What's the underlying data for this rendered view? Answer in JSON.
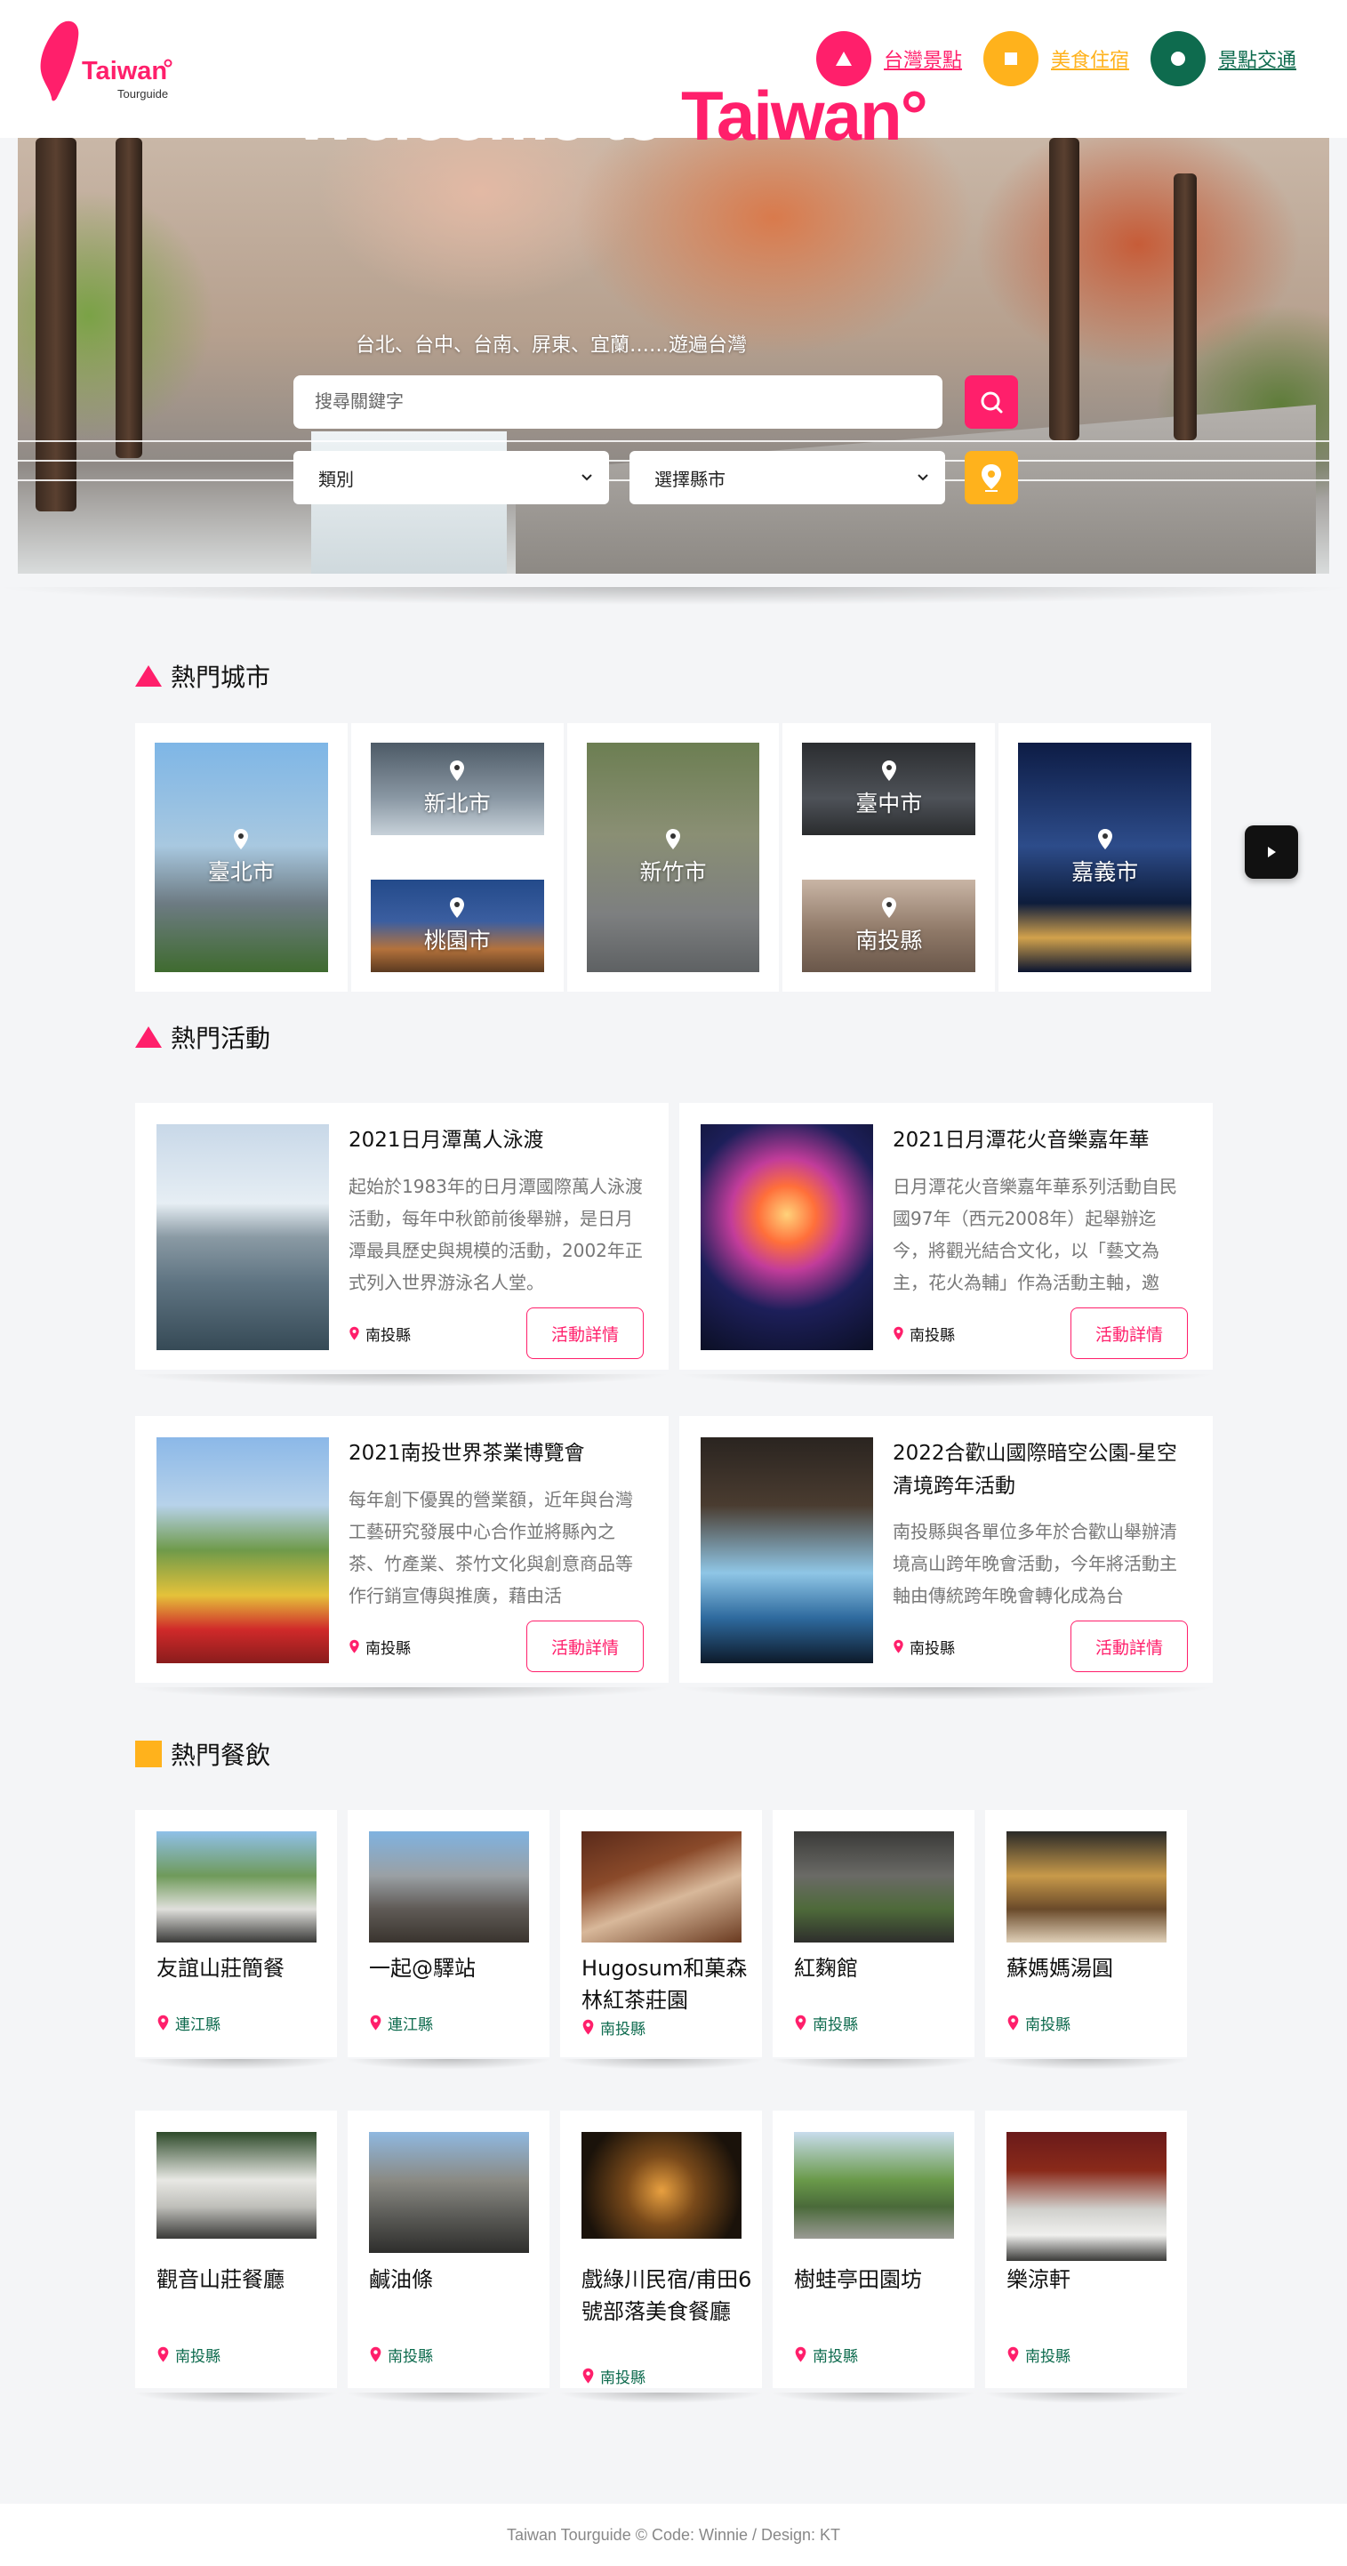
{
  "header": {
    "logo_text": "Taiwan",
    "logo_sub": "Tourguide",
    "nav": [
      {
        "label": "台灣景點",
        "color": "#ff1f6b"
      },
      {
        "label": "美食住宿",
        "color": "#ffb21c"
      },
      {
        "label": "景點交通",
        "color": "#0e6b4e"
      }
    ]
  },
  "hero": {
    "title_prefix": "Welcome to ",
    "title_accent": "Taiwan°",
    "subtitle": "台北、台中、台南、屏東、宜蘭……遊遍台灣",
    "search_placeholder": "搜尋關鍵字",
    "category_select": "類別",
    "city_select": "選擇縣市"
  },
  "sections": {
    "cities_title": "熱門城市",
    "activities_title": "熱門活動",
    "food_title": "熱門餐飲"
  },
  "cities": [
    "臺北市",
    "新北市",
    "桃園市",
    "新竹市",
    "臺中市",
    "南投縣",
    "嘉義市"
  ],
  "activities": [
    {
      "title": "2021日月潭萬人泳渡",
      "desc": "起始於1983年的日月潭國際萬人泳渡活動，每年中秋節前後舉辦，是日月潭最具歷史與規模的活動，2002年正式列入世界游泳名人堂。",
      "location": "南投縣",
      "button": "活動詳情"
    },
    {
      "title": "2021日月潭花火音樂嘉年華",
      "desc": "日月潭花火音樂嘉年華系列活動自民國97年（西元2008年）起舉辦迄今，將觀光結合文化，以「藝文為主，花火為輔」作為活動主軸，邀",
      "location": "南投縣",
      "button": "活動詳情"
    },
    {
      "title": "2021南投世界茶業博覽會",
      "desc": "每年創下優異的營業額，近年與台灣工藝研究發展中心合作並將縣內之茶、竹產業、茶竹文化與創意商品等作行銷宣傳與推廣，藉由活",
      "location": "南投縣",
      "button": "活動詳情"
    },
    {
      "title": "2022合歡山國際暗空公園-星空清境跨年活動",
      "desc": "南投縣與各單位多年於合歡山舉辦清境高山跨年晚會活動，今年將活動主軸由傳統跨年晚會轉化成為台",
      "location": "南投縣",
      "button": "活動詳情"
    }
  ],
  "restaurants": [
    {
      "name": "友誼山莊簡餐",
      "location": "連江縣"
    },
    {
      "name": "一起@驛站",
      "location": "連江縣"
    },
    {
      "name": "Hugosum和菓森林紅茶莊園",
      "location": "南投縣"
    },
    {
      "name": "紅麴館",
      "location": "南投縣"
    },
    {
      "name": "蘇媽媽湯圓",
      "location": "南投縣"
    },
    {
      "name": "觀音山莊餐廳",
      "location": "南投縣"
    },
    {
      "name": "鹹油條",
      "location": "南投縣"
    },
    {
      "name": "戲綠川民宿/甫田6號部落美食餐廳",
      "location": "南投縣"
    },
    {
      "name": "樹蛙亭田園坊",
      "location": "南投縣"
    },
    {
      "name": "樂涼軒",
      "location": "南投縣"
    }
  ],
  "footer": "Taiwan Tourguide © Code: Winnie / Design: KT",
  "colors": {
    "pink": "#ff1f6b",
    "yellow": "#ffb21c",
    "green": "#0e6b4e"
  }
}
